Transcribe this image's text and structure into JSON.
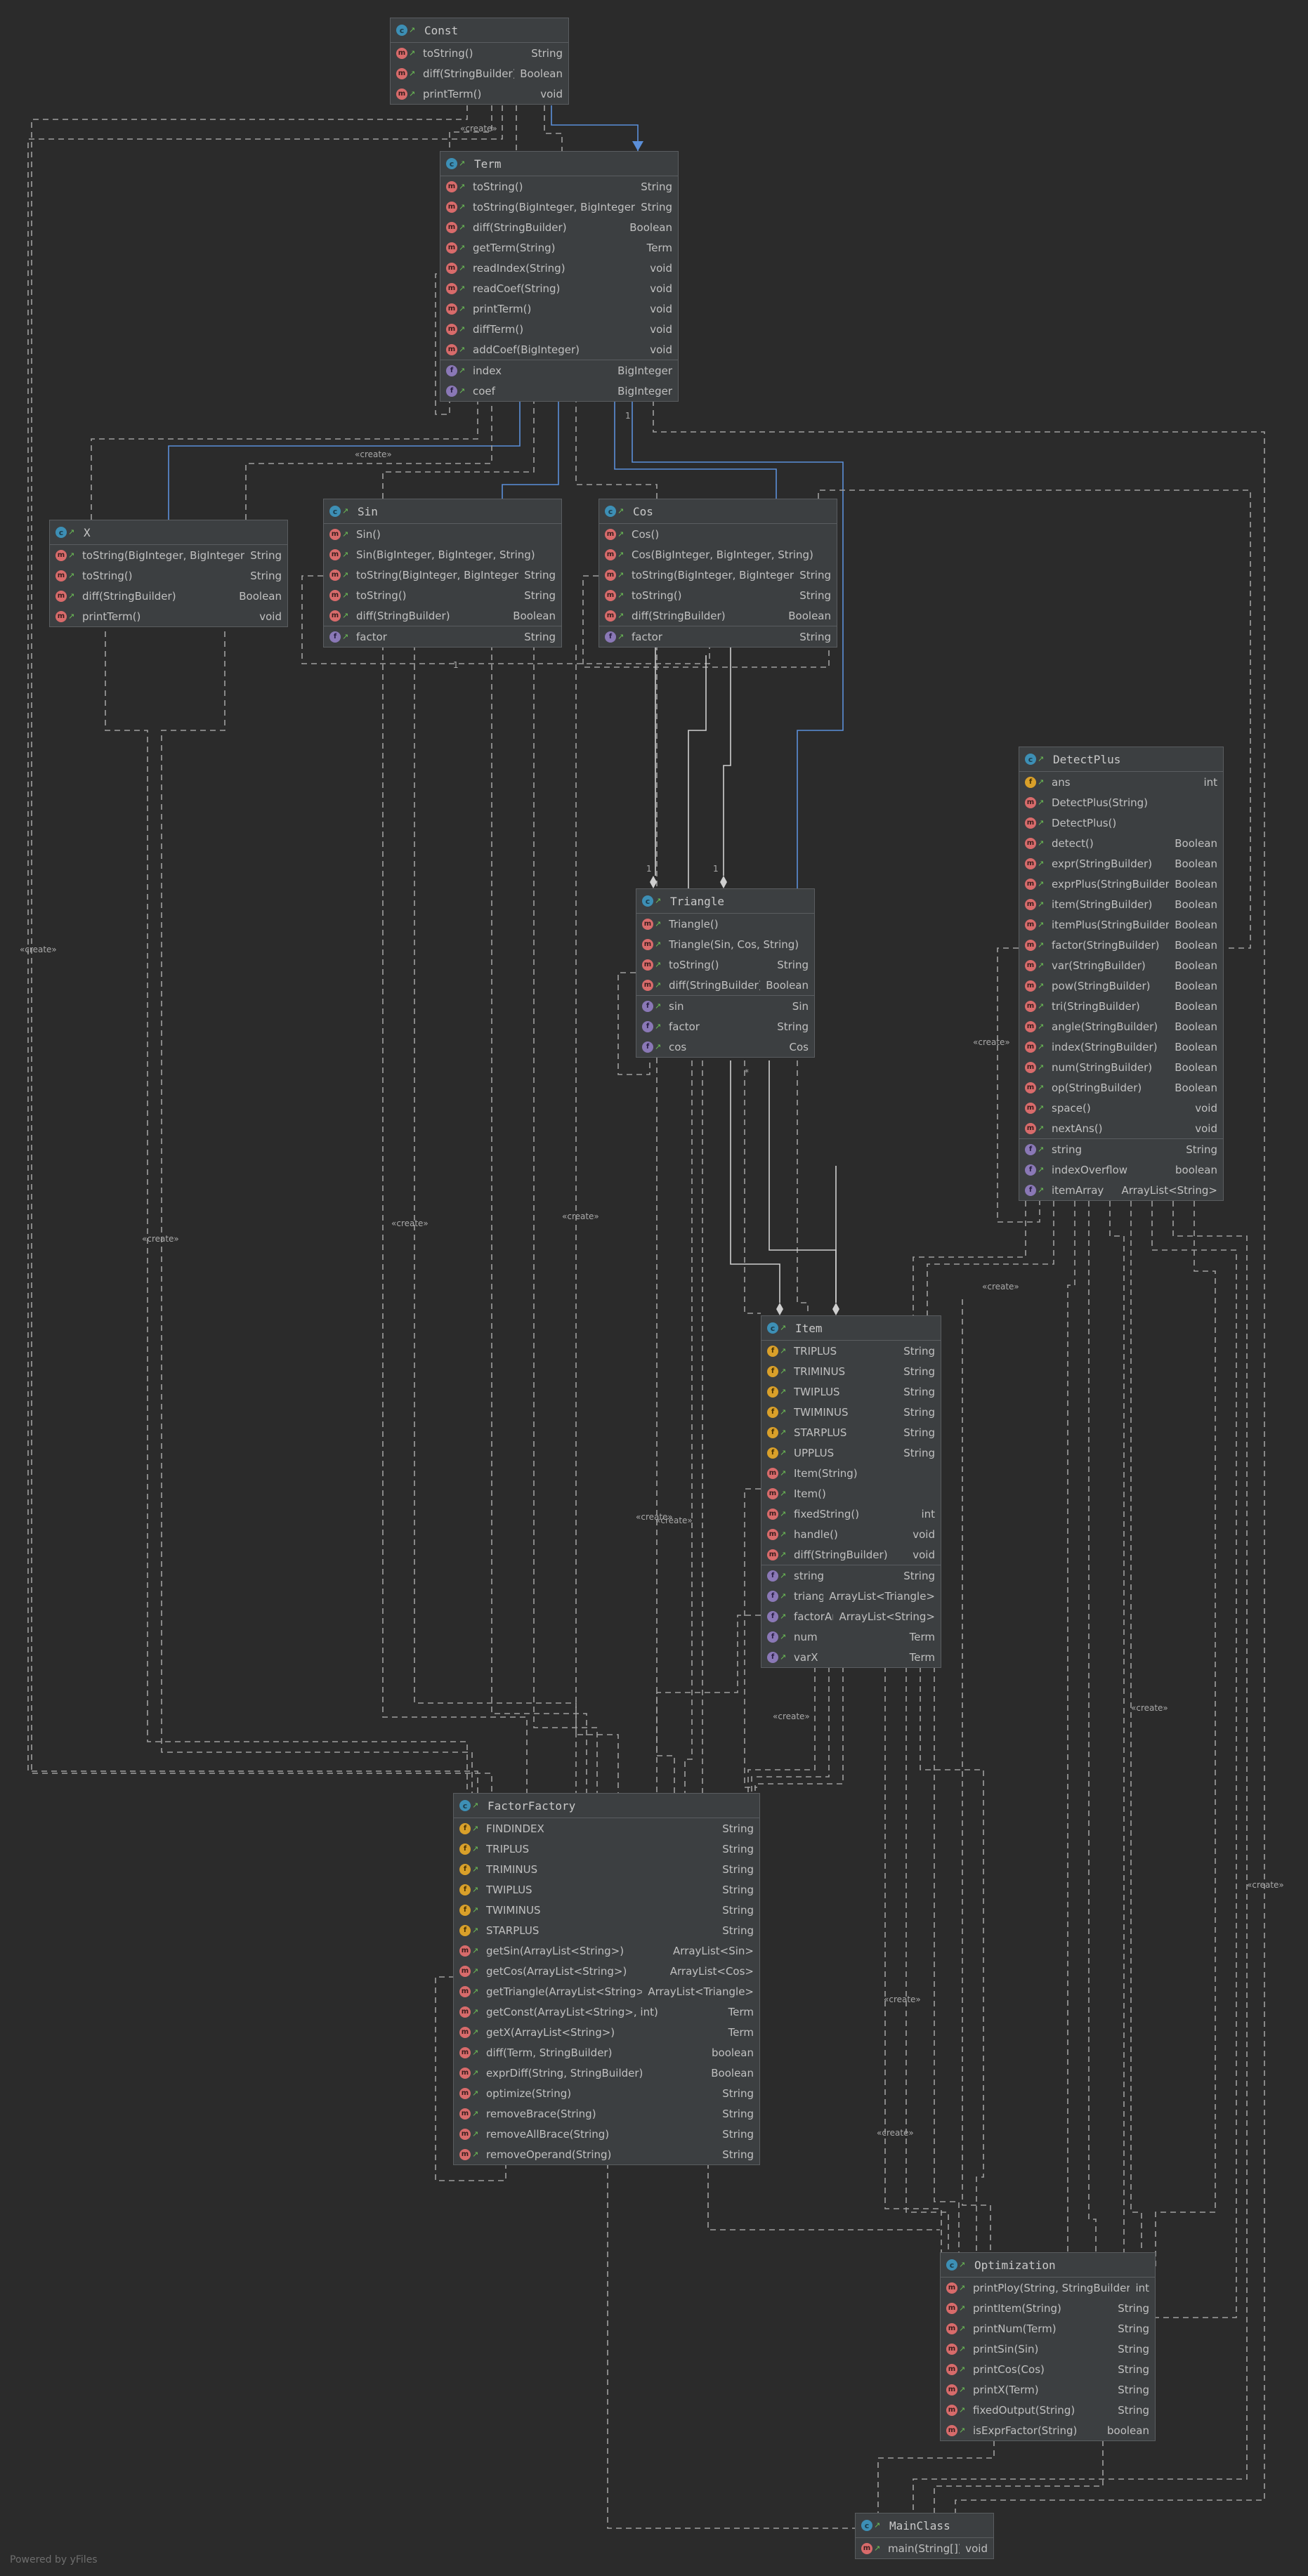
{
  "classes": {
    "const": {
      "name": "Const",
      "methods": [
        {
          "name": "toString()",
          "type": "String"
        },
        {
          "name": "diff(StringBuilder)",
          "type": "Boolean"
        },
        {
          "name": "printTerm()",
          "type": "void"
        }
      ],
      "fields": []
    },
    "term": {
      "name": "Term",
      "methods": [
        {
          "name": "toString()",
          "type": "String"
        },
        {
          "name": "toString(BigInteger, BigInteger)",
          "type": "String"
        },
        {
          "name": "diff(StringBuilder)",
          "type": "Boolean"
        },
        {
          "name": "getTerm(String)",
          "type": "Term"
        },
        {
          "name": "readIndex(String)",
          "type": "void"
        },
        {
          "name": "readCoef(String)",
          "type": "void"
        },
        {
          "name": "printTerm()",
          "type": "void"
        },
        {
          "name": "diffTerm()",
          "type": "void"
        },
        {
          "name": "addCoef(BigInteger)",
          "type": "void"
        }
      ],
      "fields": [
        {
          "name": "index",
          "type": "BigInteger"
        },
        {
          "name": "coef",
          "type": "BigInteger"
        }
      ]
    },
    "x": {
      "name": "X",
      "methods": [
        {
          "name": "toString(BigInteger, BigInteger)",
          "type": "String"
        },
        {
          "name": "toString()",
          "type": "String"
        },
        {
          "name": "diff(StringBuilder)",
          "type": "Boolean"
        },
        {
          "name": "printTerm()",
          "type": "void"
        }
      ],
      "fields": []
    },
    "sin": {
      "name": "Sin",
      "methods": [
        {
          "name": "Sin()",
          "type": ""
        },
        {
          "name": "Sin(BigInteger, BigInteger, String)",
          "type": ""
        },
        {
          "name": "toString(BigInteger, BigInteger)",
          "type": "String"
        },
        {
          "name": "toString()",
          "type": "String"
        },
        {
          "name": "diff(StringBuilder)",
          "type": "Boolean"
        }
      ],
      "fields": [
        {
          "name": "factor",
          "type": "String"
        }
      ]
    },
    "cos": {
      "name": "Cos",
      "methods": [
        {
          "name": "Cos()",
          "type": ""
        },
        {
          "name": "Cos(BigInteger, BigInteger, String)",
          "type": ""
        },
        {
          "name": "toString(BigInteger, BigInteger)",
          "type": "String"
        },
        {
          "name": "toString()",
          "type": "String"
        },
        {
          "name": "diff(StringBuilder)",
          "type": "Boolean"
        }
      ],
      "fields": [
        {
          "name": "factor",
          "type": "String"
        }
      ]
    },
    "triangle": {
      "name": "Triangle",
      "methods": [
        {
          "name": "Triangle()",
          "type": ""
        },
        {
          "name": "Triangle(Sin, Cos, String)",
          "type": ""
        },
        {
          "name": "toString()",
          "type": "String"
        },
        {
          "name": "diff(StringBuilder)",
          "type": "Boolean"
        }
      ],
      "fields": [
        {
          "name": "sin",
          "type": "Sin"
        },
        {
          "name": "factor",
          "type": "String"
        },
        {
          "name": "cos",
          "type": "Cos"
        }
      ]
    },
    "detectplus": {
      "name": "DetectPlus",
      "methods": [
        {
          "name": "ans",
          "type": "int"
        },
        {
          "name": "DetectPlus(String)",
          "type": ""
        },
        {
          "name": "DetectPlus()",
          "type": ""
        },
        {
          "name": "detect()",
          "type": "Boolean"
        },
        {
          "name": "expr(StringBuilder)",
          "type": "Boolean"
        },
        {
          "name": "exprPlus(StringBuilder)",
          "type": "Boolean"
        },
        {
          "name": "item(StringBuilder)",
          "type": "Boolean"
        },
        {
          "name": "itemPlus(StringBuilder)",
          "type": "Boolean"
        },
        {
          "name": "factor(StringBuilder)",
          "type": "Boolean"
        },
        {
          "name": "var(StringBuilder)",
          "type": "Boolean"
        },
        {
          "name": "pow(StringBuilder)",
          "type": "Boolean"
        },
        {
          "name": "tri(StringBuilder)",
          "type": "Boolean"
        },
        {
          "name": "angle(StringBuilder)",
          "type": "Boolean"
        },
        {
          "name": "index(StringBuilder)",
          "type": "Boolean"
        },
        {
          "name": "num(StringBuilder)",
          "type": "Boolean"
        },
        {
          "name": "op(StringBuilder)",
          "type": "Boolean"
        },
        {
          "name": "space()",
          "type": "void"
        },
        {
          "name": "nextAns()",
          "type": "void"
        }
      ],
      "fields": [
        {
          "name": "string",
          "type": "String"
        },
        {
          "name": "indexOverflow",
          "type": "boolean"
        },
        {
          "name": "itemArray",
          "type": "ArrayList<String>"
        }
      ]
    },
    "item": {
      "name": "Item",
      "methods": [
        {
          "name": "TRIPLUS",
          "type": "String"
        },
        {
          "name": "TRIMINUS",
          "type": "String"
        },
        {
          "name": "TWIPLUS",
          "type": "String"
        },
        {
          "name": "TWIMINUS",
          "type": "String"
        },
        {
          "name": "STARPLUS",
          "type": "String"
        },
        {
          "name": "UPPLUS",
          "type": "String"
        },
        {
          "name": "Item(String)",
          "type": ""
        },
        {
          "name": "Item()",
          "type": ""
        },
        {
          "name": "fixedString()",
          "type": "int"
        },
        {
          "name": "handle()",
          "type": "void"
        },
        {
          "name": "diff(StringBuilder)",
          "type": "void"
        }
      ],
      "fields": [
        {
          "name": "string",
          "type": "String"
        },
        {
          "name": "triangle",
          "type": "ArrayList<Triangle>"
        },
        {
          "name": "factorArray",
          "type": "ArrayList<String>"
        },
        {
          "name": "num",
          "type": "Term"
        },
        {
          "name": "varX",
          "type": "Term"
        }
      ]
    },
    "factorfactory": {
      "name": "FactorFactory",
      "methods": [
        {
          "name": "FINDINDEX",
          "type": "String"
        },
        {
          "name": "TRIPLUS",
          "type": "String"
        },
        {
          "name": "TRIMINUS",
          "type": "String"
        },
        {
          "name": "TWIPLUS",
          "type": "String"
        },
        {
          "name": "TWIMINUS",
          "type": "String"
        },
        {
          "name": "STARPLUS",
          "type": "String"
        },
        {
          "name": "getSin(ArrayList<String>)",
          "type": "ArrayList<Sin>"
        },
        {
          "name": "getCos(ArrayList<String>)",
          "type": "ArrayList<Cos>"
        },
        {
          "name": "getTriangle(ArrayList<String>)",
          "type": "ArrayList<Triangle>"
        },
        {
          "name": "getConst(ArrayList<String>, int)",
          "type": "Term"
        },
        {
          "name": "getX(ArrayList<String>)",
          "type": "Term"
        },
        {
          "name": "diff(Term, StringBuilder)",
          "type": "boolean"
        },
        {
          "name": "exprDiff(String, StringBuilder)",
          "type": "Boolean"
        },
        {
          "name": "optimize(String)",
          "type": "String"
        },
        {
          "name": "removeBrace(String)",
          "type": "String"
        },
        {
          "name": "removeAllBrace(String)",
          "type": "String"
        },
        {
          "name": "removeOperand(String)",
          "type": "String"
        }
      ],
      "fields": []
    },
    "optimization": {
      "name": "Optimization",
      "methods": [
        {
          "name": "printPloy(String, StringBuilder)",
          "type": "int"
        },
        {
          "name": "printItem(String)",
          "type": "String"
        },
        {
          "name": "printNum(Term)",
          "type": "String"
        },
        {
          "name": "printSin(Sin)",
          "type": "String"
        },
        {
          "name": "printCos(Cos)",
          "type": "String"
        },
        {
          "name": "printX(Term)",
          "type": "String"
        },
        {
          "name": "fixedOutput(String)",
          "type": "String"
        },
        {
          "name": "isExprFactor(String)",
          "type": "boolean"
        }
      ],
      "fields": []
    },
    "mainclass": {
      "name": "MainClass",
      "methods": [
        {
          "name": "main(String[])",
          "type": "void"
        }
      ],
      "fields": []
    }
  },
  "edge_labels": {
    "create": "«create»",
    "one": "1",
    "many": "*"
  },
  "footer": "Powered by yFiles",
  "colors": {
    "background": "#2b2b2b",
    "node": "#3c3f41",
    "dependency": "#a0a0a0",
    "inheritance": "#5b8fd9"
  }
}
